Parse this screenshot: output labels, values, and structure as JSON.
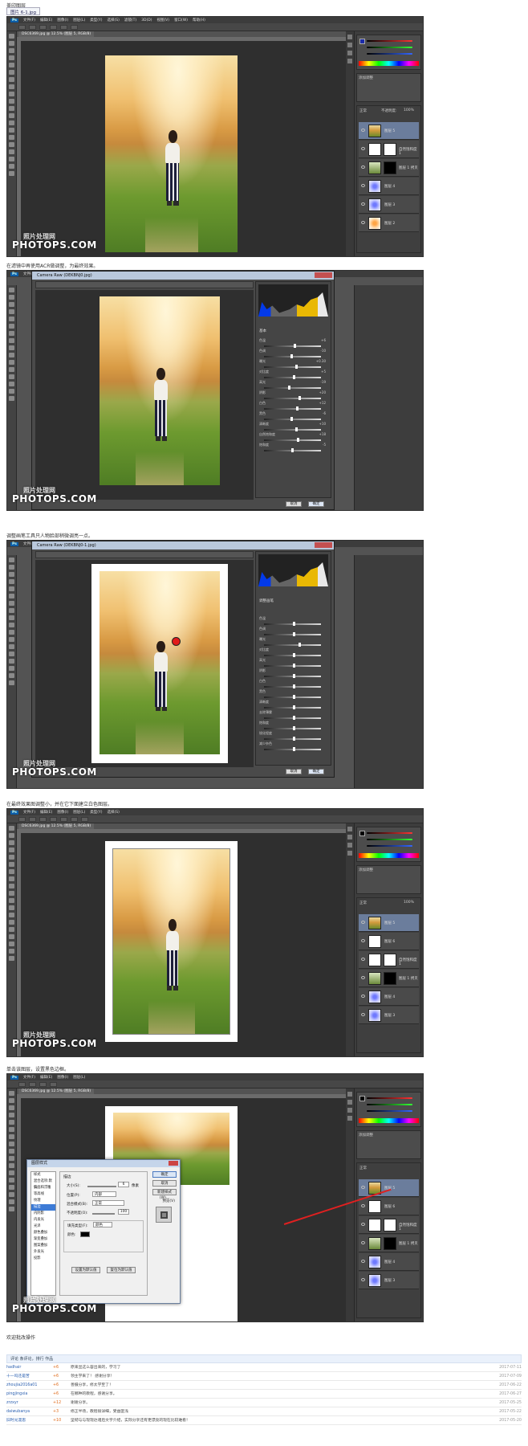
{
  "top_tab": "图片 6-1.jpg",
  "captions": {
    "c1": "盖印图层",
    "c2": "在滤镜中再使用ACR做调整，为最终效果。",
    "c3": "调整画笔工具只人物脸部稍微调亮一点。",
    "c4": "在最终效果图调整小，并在它下面建立白色图层。",
    "c5": "单击该图层，设置黑色边框。",
    "c6": "欢迎批改操作"
  },
  "ps": {
    "logo": "Ps",
    "menus": [
      "文件(F)",
      "编辑(E)",
      "图像(I)",
      "图层(L)",
      "类型(Y)",
      "选择(S)",
      "滤镜(T)",
      "3D(D)",
      "视图(V)",
      "窗口(W)",
      "帮助(H)"
    ],
    "doc_tab": "DSC6369.jpg @ 12.5% (图层 5, RGB/8)",
    "blend_mode": "正常",
    "opacity_label": "不透明度:",
    "opacity": "100%",
    "fill_label": "填充:",
    "fill": "100%",
    "adjust_label": "添加调整",
    "layers1": [
      "图层 5",
      "自然饱和度 1",
      "图层 1 拷贝",
      "图层 4",
      "图层 3",
      "图层 2"
    ],
    "layers4": [
      "图层 5",
      "图层 6",
      "自然饱和度 1",
      "图层 1 拷贝",
      "图层 4",
      "图层 3"
    ],
    "layers5": [
      "图层 5",
      "图层 6",
      "自然饱和度 1",
      "图层 1 拷贝",
      "图层 4",
      "图层 3"
    ]
  },
  "watermark": {
    "site": "照片处理网",
    "domain": "PHOTOPS.COM"
  },
  "camera_raw": {
    "title": "Camera Raw (DEKBNJ0.jpg)",
    "title2": "Camera Raw (DEKBNJ0-1.jpg)",
    "basic_label": "基本",
    "rows": [
      "色温",
      "色调",
      "曝光",
      "对比度",
      "高光",
      "阴影",
      "白色",
      "黑色",
      "清晰度",
      "自然饱和度",
      "饱和度"
    ],
    "values": [
      "+6",
      "-10",
      "+0.30",
      "+5",
      "-19",
      "+20",
      "+12",
      "-6",
      "+10",
      "+18",
      "-5"
    ],
    "brush_label": "调整画笔",
    "brush_rows": [
      "色温",
      "色调",
      "曝光",
      "对比度",
      "高光",
      "阴影",
      "白色",
      "黑色",
      "清晰度",
      "去除薄雾",
      "饱和度",
      "锐化程度",
      "减少杂色"
    ],
    "cancel": "取消",
    "ok": "确定"
  },
  "layer_style": {
    "title": "图层样式",
    "styles": [
      "样式",
      "混合选项:默认",
      "斜面和浮雕",
      "等高线",
      "纹理",
      "描边",
      "内阴影",
      "内发光",
      "光泽",
      "颜色叠加",
      "渐变叠加",
      "图案叠加",
      "外发光",
      "投影"
    ],
    "group_title": "描边",
    "size_label": "大小(S):",
    "size": "6",
    "size_unit": "像素",
    "position_label": "位置(P):",
    "position": "内部",
    "blend_label": "混合模式(B):",
    "blend": "正常",
    "opacity_label": "不透明度(O):",
    "opacity": "100",
    "fill_type_label": "填充类型(F):",
    "fill_type": "颜色",
    "color_label": "颜色:",
    "default_btn": "设置为默认值",
    "reset_btn": "复位为默认值",
    "ok": "确定",
    "cancel": "取消",
    "new_style": "新建样式(W)...",
    "preview": "预览(V)"
  },
  "comments": {
    "header": "评论 条评论，排行  作品",
    "rows": [
      {
        "user": "hadhair",
        "score": "+6",
        "text": "原来显这么容出来的，学习了",
        "date": "2017-07-11"
      },
      {
        "user": "十一吗还是苦",
        "score": "+6",
        "text": "领主学来了！ 感谢分享！",
        "date": "2017-07-09"
      },
      {
        "user": "zhoujia2016a01",
        "score": "+6",
        "text": "善摄分享，修太学至了！",
        "date": "2017-06-22"
      },
      {
        "user": "pingjingxia",
        "score": "+6",
        "text": "在哪种的教程，感谢分享。",
        "date": "2017-06-27"
      },
      {
        "user": "zrzxyr",
        "score": "+12",
        "text": "谢谢分享。",
        "date": "2017-05-25"
      },
      {
        "user": "daiwubanya",
        "score": "+3",
        "text": "修正半场，教程很详细，受益匪浅",
        "date": "2017-05-22"
      },
      {
        "user": "旧时光漫思",
        "score": "+10",
        "text": "坚韧与与现现达诸后文字介绍，实际分享还有更漂亮的现在比较难看！",
        "date": "2017-05-20"
      }
    ]
  }
}
